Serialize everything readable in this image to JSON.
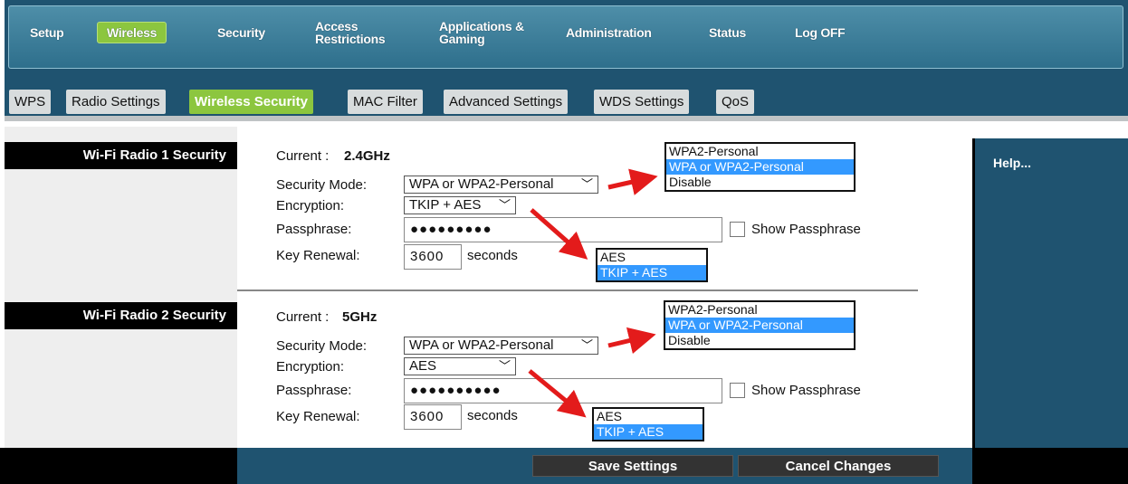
{
  "top_nav": {
    "items": [
      {
        "label": "Setup",
        "active": false
      },
      {
        "label": "Wireless",
        "active": true
      },
      {
        "label": "Security",
        "active": false
      },
      {
        "label": "Access Restrictions",
        "active": false
      },
      {
        "label": "Applications & Gaming",
        "active": false
      },
      {
        "label": "Administration",
        "active": false
      },
      {
        "label": "Status",
        "active": false
      },
      {
        "label": "Log OFF",
        "active": false
      }
    ]
  },
  "sub_nav": {
    "tabs": [
      {
        "label": "WPS",
        "active": false
      },
      {
        "label": "Radio Settings",
        "active": false
      },
      {
        "label": "Wireless Security",
        "active": true
      },
      {
        "label": "MAC Filter",
        "active": false
      },
      {
        "label": "Advanced Settings",
        "active": false
      },
      {
        "label": "WDS Settings",
        "active": false
      },
      {
        "label": "QoS",
        "active": false
      }
    ]
  },
  "radio1": {
    "section_label": "Wi-Fi Radio 1 Security",
    "current_label": "Current :",
    "current_value": "2.4GHz",
    "security_mode_label": "Security Mode:",
    "security_mode_value": "WPA or WPA2-Personal",
    "encryption_label": "Encryption:",
    "encryption_value": "TKIP + AES",
    "passphrase_label": "Passphrase:",
    "passphrase_value": "●●●●●●●●●",
    "show_passphrase_label": "Show Passphrase",
    "key_renewal_label": "Key Renewal:",
    "key_renewal_value": "3600",
    "key_renewal_unit": "seconds",
    "mode_options": [
      "WPA2-Personal",
      "WPA or WPA2-Personal",
      "Disable"
    ],
    "mode_selected_index": 1,
    "encryption_options": [
      "AES",
      "TKIP + AES"
    ],
    "encryption_selected_index": 1
  },
  "radio2": {
    "section_label": "Wi-Fi Radio 2 Security",
    "current_label": "Current :",
    "current_value": "5GHz",
    "security_mode_label": "Security Mode:",
    "security_mode_value": "WPA or WPA2-Personal",
    "encryption_label": "Encryption:",
    "encryption_value": "AES",
    "passphrase_label": "Passphrase:",
    "passphrase_value": "●●●●●●●●●●",
    "show_passphrase_label": "Show Passphrase",
    "key_renewal_label": "Key Renewal:",
    "key_renewal_value": "3600",
    "key_renewal_unit": "seconds",
    "mode_options": [
      "WPA2-Personal",
      "WPA or WPA2-Personal",
      "Disable"
    ],
    "mode_selected_index": 1,
    "encryption_options": [
      "AES",
      "TKIP + AES"
    ],
    "encryption_selected_index": 1
  },
  "help": {
    "label": "Help..."
  },
  "footer": {
    "save_label": "Save Settings",
    "cancel_label": "Cancel Changes"
  },
  "colors": {
    "nav_blue": "#1f5370",
    "active_green": "#8cc63f",
    "highlight_blue": "#3399ff",
    "arrow_red": "#e31b1b"
  }
}
